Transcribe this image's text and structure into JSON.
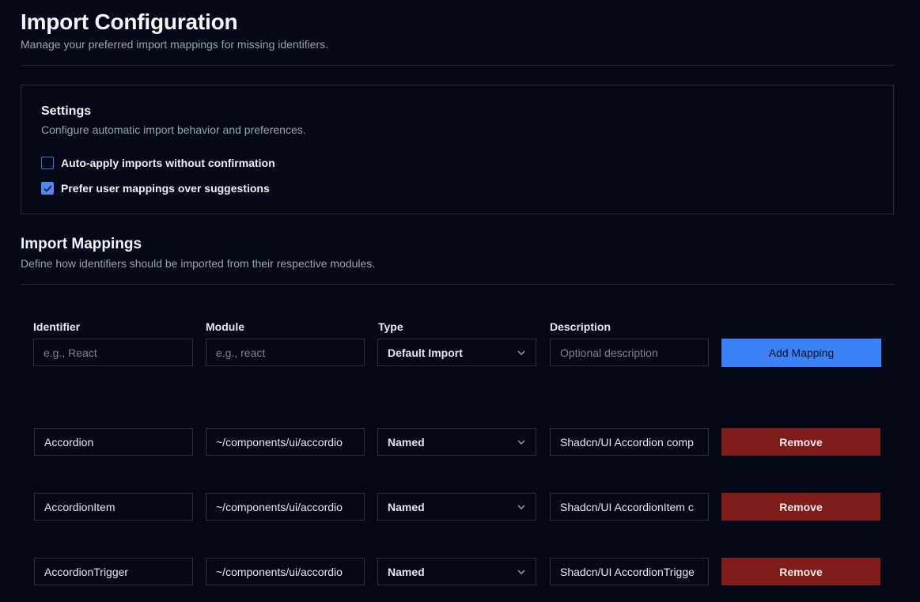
{
  "header": {
    "title": "Import Configuration",
    "subtitle": "Manage your preferred import mappings for missing identifiers."
  },
  "settings": {
    "title": "Settings",
    "description": "Configure automatic import behavior and preferences.",
    "options": [
      {
        "label": "Auto-apply imports without confirmation",
        "checked": false
      },
      {
        "label": "Prefer user mappings over suggestions",
        "checked": true
      }
    ]
  },
  "mappings": {
    "title": "Import Mappings",
    "description": "Define how identifiers should be imported from their respective modules.",
    "columns": {
      "identifier": "Identifier",
      "module": "Module",
      "type": "Type",
      "description": "Description"
    },
    "new_row": {
      "identifier_placeholder": "e.g., React",
      "module_placeholder": "e.g., react",
      "type": "Default Import",
      "description_placeholder": "Optional description",
      "add_label": "Add Mapping"
    },
    "rows": [
      {
        "identifier": "Accordion",
        "module": "~/components/ui/accordio",
        "type": "Named",
        "description": "Shadcn/UI Accordion comp",
        "remove_label": "Remove"
      },
      {
        "identifier": "AccordionItem",
        "module": "~/components/ui/accordio",
        "type": "Named",
        "description": "Shadcn/UI AccordionItem c",
        "remove_label": "Remove"
      },
      {
        "identifier": "AccordionTrigger",
        "module": "~/components/ui/accordio",
        "type": "Named",
        "description": "Shadcn/UI AccordionTrigge",
        "remove_label": "Remove"
      }
    ]
  },
  "colors": {
    "background": "#050816",
    "accent": "#3b82f6",
    "danger": "#7f1d1d"
  },
  "icons": {
    "select": "chevron-down-icon",
    "checked": "check-icon"
  }
}
